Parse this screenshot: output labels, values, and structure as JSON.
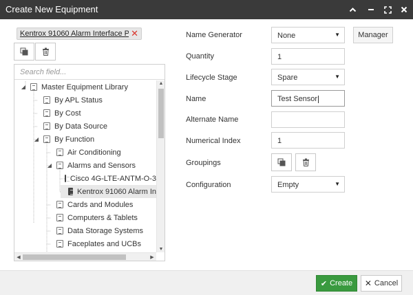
{
  "window": {
    "title": "Create New Equipment",
    "controls": [
      "chevron-up-icon",
      "minimize-icon",
      "expand-icon",
      "close-icon"
    ]
  },
  "selected_tag": {
    "label": "Kentrox 91060 Alarm Interface P...",
    "remove": "✕"
  },
  "tree": {
    "search_placeholder": "Search field...",
    "items": [
      {
        "label": "Master Equipment Library",
        "level": 0,
        "expanded": true
      },
      {
        "label": "By APL Status",
        "level": 1,
        "expanded": false
      },
      {
        "label": "By Cost",
        "level": 1,
        "expanded": false
      },
      {
        "label": "By Data Source",
        "level": 1,
        "expanded": false
      },
      {
        "label": "By Function",
        "level": 1,
        "expanded": true
      },
      {
        "label": "Air Conditioning",
        "level": 2,
        "expanded": false
      },
      {
        "label": "Alarms and Sensors",
        "level": 2,
        "expanded": true
      },
      {
        "label": "Cisco 4G-LTE-ANTM-O-3",
        "level": 3,
        "leaf": true
      },
      {
        "label": "Kentrox 91060 Alarm In",
        "level": 3,
        "leaf": true,
        "selected": true
      },
      {
        "label": "Cards and Modules",
        "level": 2,
        "expanded": false
      },
      {
        "label": "Computers & Tablets",
        "level": 2,
        "expanded": false
      },
      {
        "label": "Data Storage Systems",
        "level": 2,
        "expanded": false
      },
      {
        "label": "Faceplates and UCBs",
        "level": 2,
        "expanded": false
      }
    ]
  },
  "form": {
    "name_generator": {
      "label": "Name Generator",
      "value": "None"
    },
    "manager_button": "Manager",
    "quantity": {
      "label": "Quantity",
      "value": "1"
    },
    "lifecycle_stage": {
      "label": "Lifecycle Stage",
      "value": "Spare"
    },
    "name": {
      "label": "Name",
      "value": "Test Sensor"
    },
    "alternate_name": {
      "label": "Alternate Name",
      "value": ""
    },
    "numerical_index": {
      "label": "Numerical Index",
      "value": "1"
    },
    "groupings": {
      "label": "Groupings"
    },
    "configuration": {
      "label": "Configuration",
      "value": "Empty"
    }
  },
  "footer": {
    "create_label": "Create",
    "cancel_label": "Cancel"
  },
  "colors": {
    "titlebar": "#3a3a3a",
    "create_button": "#3a9a3f",
    "remove_x": "#d9342b"
  }
}
